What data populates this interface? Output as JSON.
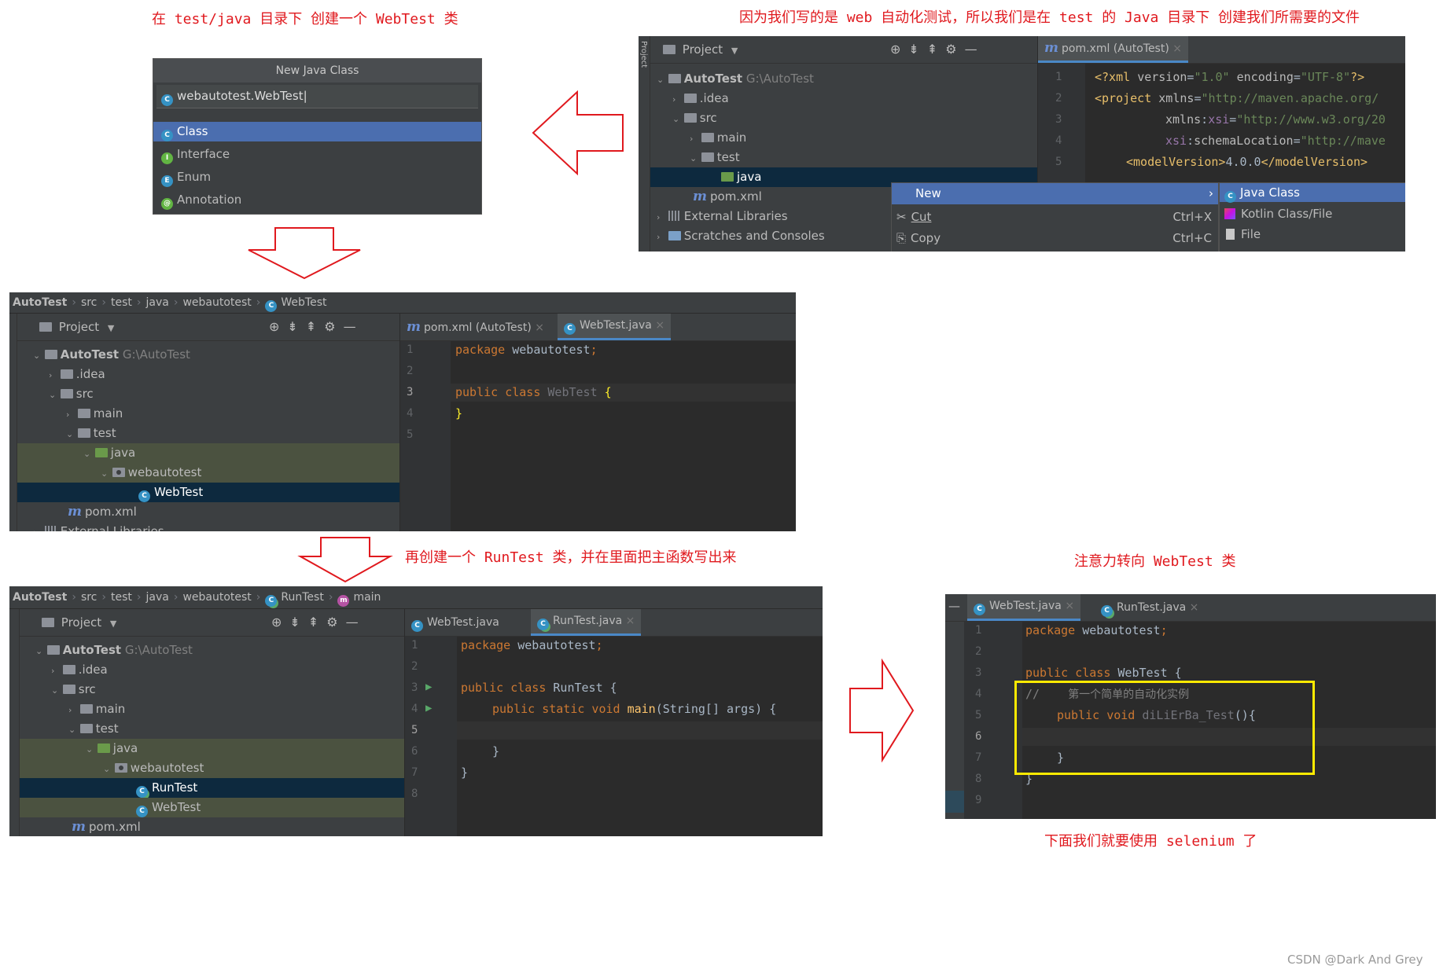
{
  "notes": {
    "create_class": "在 test/java 目录下 创建一个 WebTest 类",
    "reason": "因为我们写的是 web 自动化测试，所以我们是在 test 的 Java 目录下 创建我们所需要的文件",
    "runtest": "再创建一个 RunTest 类，并在里面把主函数写出来",
    "focus": "注意力转向 WebTest 类",
    "selenium": "下面我们就要使用 selenium 了"
  },
  "watermark": "CSDN @Dark And Grey",
  "dialog": {
    "title": "New Java Class",
    "input_value": "webautotest.WebTest",
    "options": [
      "Class",
      "Interface",
      "Enum",
      "Annotation"
    ],
    "option_icons": [
      "C",
      "I",
      "E",
      "@"
    ]
  },
  "shot1": {
    "project_label": "Project",
    "tab": "pom.xml (AutoTest)",
    "tree": {
      "root": "AutoTest",
      "root_path": "G:\\AutoTest",
      "idea": ".idea",
      "src": "src",
      "main": "main",
      "test": "test",
      "java": "java",
      "pom": "pom.xml",
      "ext": "External Libraries",
      "scratch": "Scratches and Consoles"
    },
    "lines": [
      "1",
      "2",
      "3",
      "4",
      "5"
    ],
    "menu": {
      "new": "New",
      "cut": "Cut",
      "cut_key": "Ctrl+X",
      "copy": "Copy",
      "copy_key": "Ctrl+C"
    },
    "submenu": [
      "Java Class",
      "Kotlin Class/File",
      "File"
    ]
  },
  "shot2": {
    "crumbs": [
      "AutoTest",
      "src",
      "test",
      "java",
      "webautotest",
      "WebTest"
    ],
    "project_label": "Project",
    "tabs": [
      "pom.xml (AutoTest)",
      "WebTest.java"
    ],
    "tree": {
      "root": "AutoTest",
      "root_path": "G:\\AutoTest",
      "idea": ".idea",
      "src": "src",
      "main": "main",
      "test": "test",
      "java": "java",
      "pkg": "webautotest",
      "cls": "WebTest",
      "pom": "pom.xml",
      "ext": "External Libraries"
    },
    "lines": [
      "1",
      "2",
      "3",
      "4",
      "5"
    ]
  },
  "shot3": {
    "crumbs": [
      "AutoTest",
      "src",
      "test",
      "java",
      "webautotest",
      "RunTest",
      "main"
    ],
    "project_label": "Project",
    "tabs": [
      "WebTest.java",
      "RunTest.java"
    ],
    "tree": {
      "root": "AutoTest",
      "root_path": "G:\\AutoTest",
      "idea": ".idea",
      "src": "src",
      "main": "main",
      "test": "test",
      "java": "java",
      "pkg": "webautotest",
      "run": "RunTest",
      "web": "WebTest",
      "pom": "pom.xml"
    },
    "lines": [
      "1",
      "2",
      "3",
      "4",
      "5",
      "6",
      "7",
      "8"
    ]
  },
  "shot4": {
    "tabs": [
      "WebTest.java",
      "RunTest.java"
    ],
    "lines": [
      "1",
      "2",
      "3",
      "4",
      "5",
      "6",
      "7",
      "8",
      "9"
    ],
    "comment_text": "第一个简单的自动化实例"
  },
  "colors": {
    "annotation_red": "#e0191e",
    "highlight_yellow": "#ffea00",
    "ide_bg": "#2b2b2b",
    "selection_blue": "#4b6eaf"
  }
}
